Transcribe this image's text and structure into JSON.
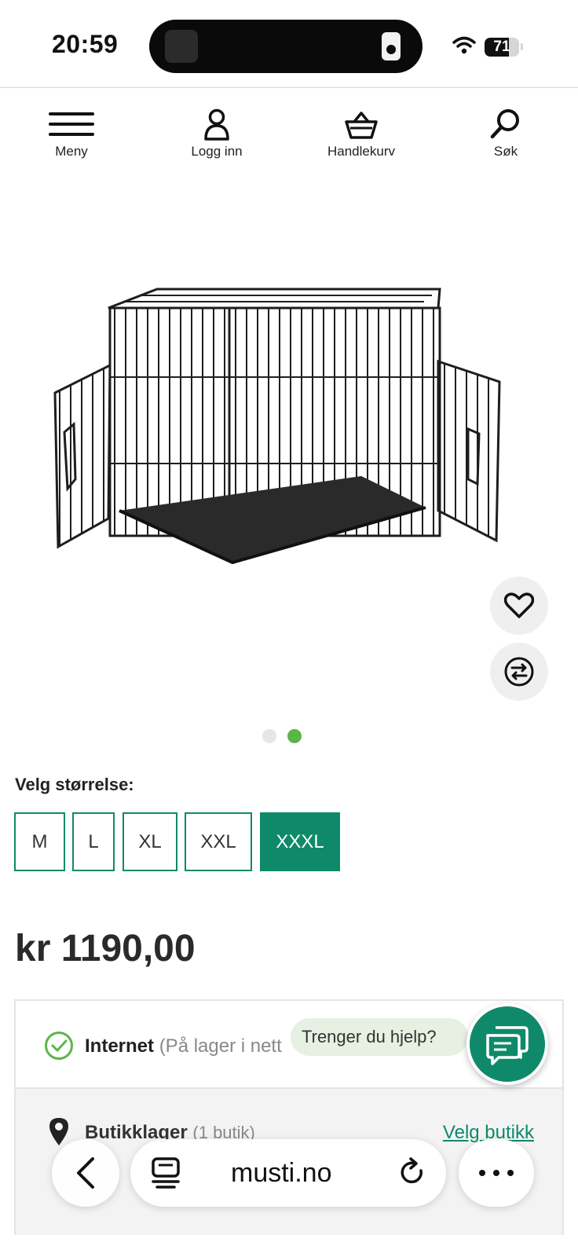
{
  "status_bar": {
    "time": "20:59",
    "battery_level": "71",
    "battery_fraction": 0.71
  },
  "header_nav": [
    {
      "label": "Meny",
      "icon": "hamburger-menu-icon"
    },
    {
      "label": "Logg inn",
      "icon": "user-icon"
    },
    {
      "label": "Handlekurv",
      "icon": "basket-icon"
    },
    {
      "label": "Søk",
      "icon": "search-icon"
    }
  ],
  "product": {
    "image": "wire-dog-crate-image",
    "carousel": {
      "total": 2,
      "active": 2
    }
  },
  "size_picker": {
    "label": "Velg størrelse:",
    "options": [
      "M",
      "L",
      "XL",
      "XXL",
      "XXXL"
    ],
    "selected": "XXXL"
  },
  "price": "kr 1190,00",
  "availability": {
    "internet_title": "Internet",
    "internet_status": "(På lager i nett",
    "store_title": "Butikklager",
    "store_count": "(1 butik)",
    "store_link": "Velg butikk"
  },
  "chat": {
    "prompt": "Trenger du hjelp?"
  },
  "browser": {
    "url": "musti.no"
  },
  "colors": {
    "brand_green": "#0e8a6a",
    "check_green": "#5bb548",
    "dot_active": "#5bb548",
    "dot_inactive": "#e6e6e6"
  }
}
